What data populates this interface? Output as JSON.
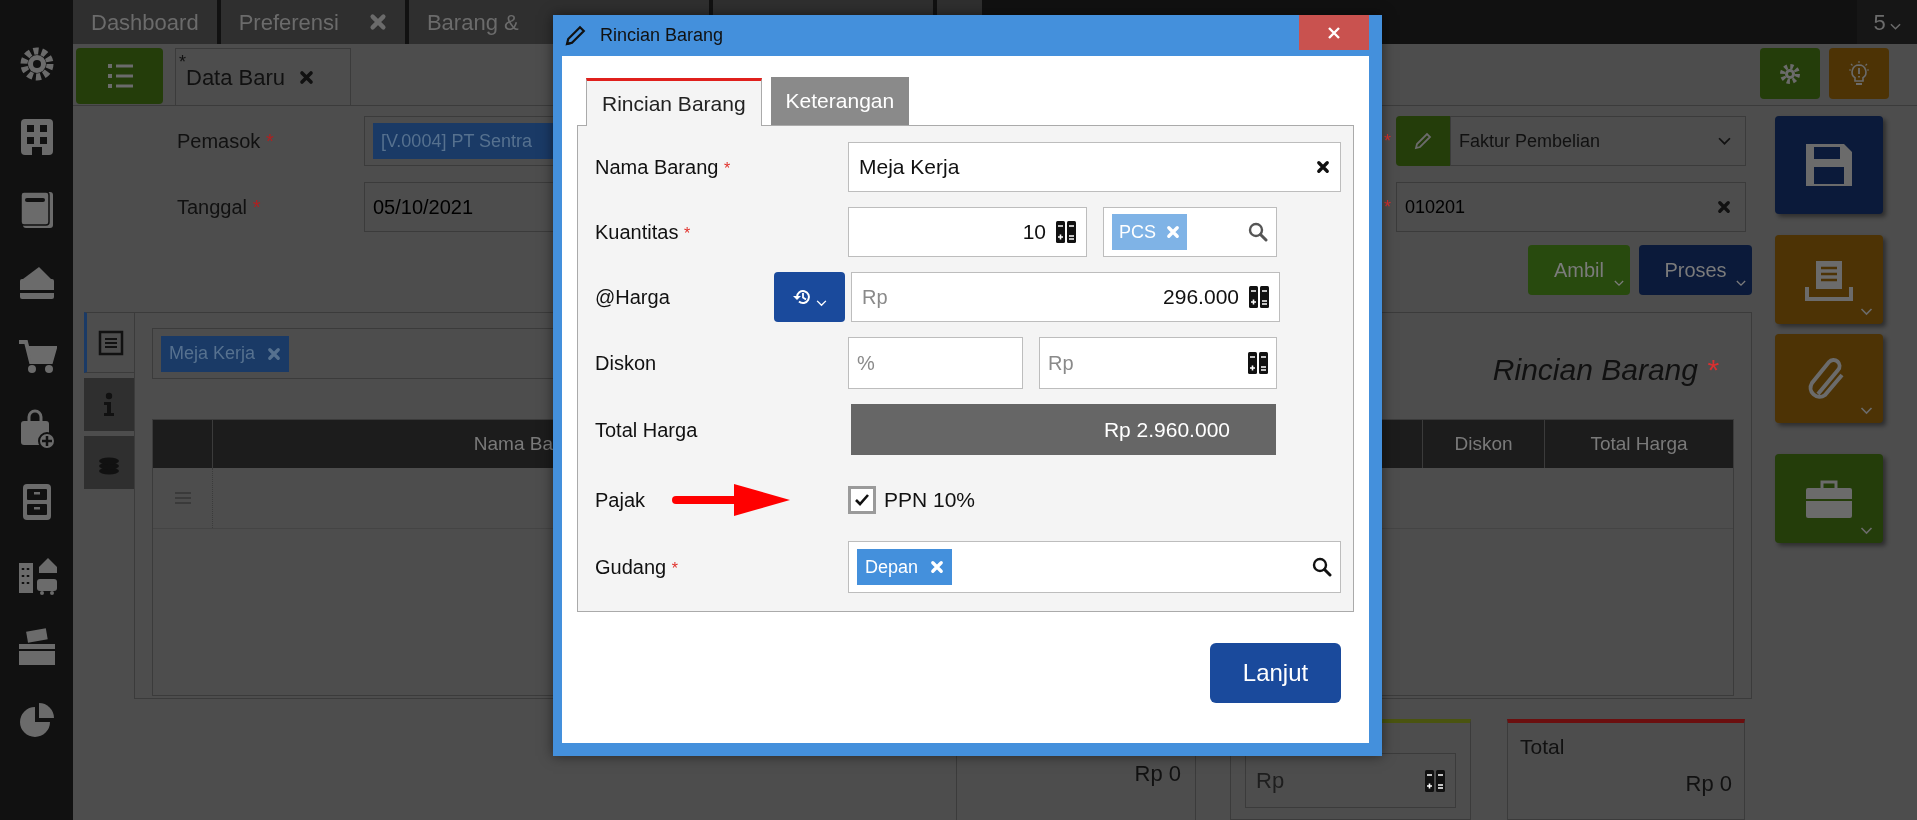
{
  "top_tabs": [
    {
      "label": "Dashboard",
      "closable": false
    },
    {
      "label": "Preferensi",
      "closable": true
    },
    {
      "label": "Barang &",
      "closable": false
    }
  ],
  "window_count": "5",
  "document_tabs": [
    {
      "label": "Data Baru",
      "modified_mark": "*",
      "selected": true
    }
  ],
  "form": {
    "supplier": {
      "label": "Pemasok",
      "required": true,
      "tag": "[V.0004] PT Sentra"
    },
    "date": {
      "label": "Tanggal",
      "required": true,
      "value": "05/10/2021"
    },
    "document_type": {
      "required": true,
      "value": "Faktur Pembelian"
    },
    "number": {
      "required": true,
      "value": "010201"
    }
  },
  "actions": [
    "Ambil",
    "Proses"
  ],
  "detail": {
    "side_tabs": [
      {
        "selected": true
      },
      {
        "selected": false
      },
      {
        "selected": false
      }
    ],
    "item_tag": "Meja Kerja",
    "title": "Rincian Barang",
    "title_required": true,
    "columns": [
      "Nama Ba",
      "Diskon",
      "Total Harga"
    ]
  },
  "summary": {
    "subtotal": "Rp 0",
    "discount_placeholder": "Rp",
    "total_label": "Total",
    "total": "Rp 0"
  },
  "dialog": {
    "title": "Rincian Barang",
    "tabs": [
      {
        "label": "Rincian Barang",
        "selected": true
      },
      {
        "label": "Keterangan",
        "selected": false
      }
    ],
    "name": {
      "label": "Nama Barang",
      "required": true,
      "value": "Meja Kerja"
    },
    "quantity": {
      "label": "Kuantitas",
      "required": true,
      "value": "10",
      "unit": "PCS"
    },
    "price": {
      "label": "@Harga",
      "prefix": "Rp",
      "value": "296.000"
    },
    "discount": {
      "label": "Diskon",
      "percent_placeholder": "%",
      "amount_placeholder": "Rp"
    },
    "total": {
      "label": "Total Harga",
      "value": "Rp 2.960.000"
    },
    "tax": {
      "label": "Pajak",
      "option": "PPN 10%",
      "checked": true
    },
    "warehouse": {
      "label": "Gudang",
      "required": true,
      "tag": "Depan"
    },
    "submit": "Lanjut"
  }
}
